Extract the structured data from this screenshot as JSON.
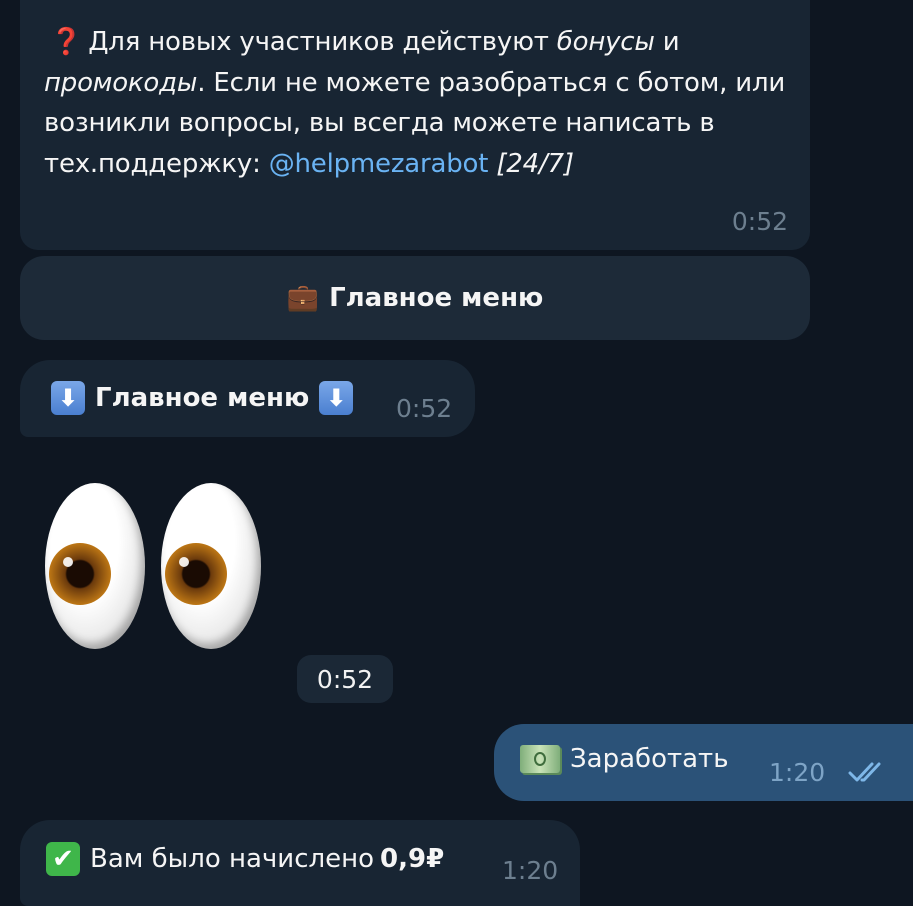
{
  "message_info": {
    "icon": "question-mark-icon",
    "glyph": "❓",
    "t1": "Для новых участников действуют ",
    "t2": "бонусы",
    "t3": " и",
    "t4": "промокоды",
    "t5": ". Если не можете разобраться с ботом, или возникли вопросы, вы всегда можете написать в тех.поддержку: ",
    "link": "@helpmezarabot",
    "t6": " ",
    "t7": "[24/7]",
    "time": "0:52"
  },
  "keyboard_button": {
    "icon": "briefcase-icon",
    "glyph": "💼",
    "label": "Главное меню"
  },
  "message_menu": {
    "arrow_glyph": "⬇",
    "label": "Главное меню",
    "time": "0:52"
  },
  "sticker": {
    "icon": "eyes-icon",
    "time": "0:52"
  },
  "outgoing": {
    "icon": "money-icon",
    "label": "Заработать",
    "time": "1:20",
    "status_icon": "double-check-icon"
  },
  "message_credit": {
    "check_glyph": "✔",
    "text": "Вам было начислено ",
    "amount": "0,9₽",
    "time": "1:20"
  },
  "colors": {
    "background": "#0e1621",
    "incoming_bubble": "#182533",
    "outgoing_bubble": "#2b5278",
    "link": "#6ab3f3",
    "time_gray": "#6d7f8f"
  }
}
